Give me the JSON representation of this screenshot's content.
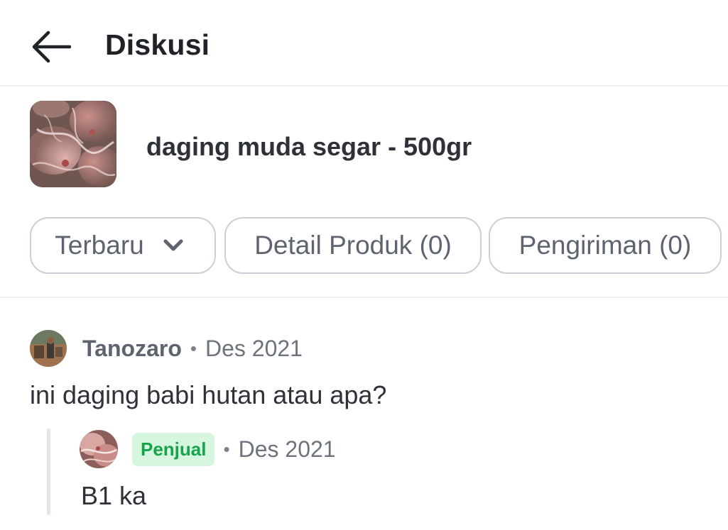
{
  "header": {
    "title": "Diskusi",
    "back_icon": "arrow-left-icon"
  },
  "product": {
    "name": "daging muda segar - 500gr"
  },
  "filters": {
    "sort_label": "Terbaru",
    "sort_icon": "chevron-down-icon",
    "tabs": [
      {
        "label": "Detail Produk (0)"
      },
      {
        "label": "Pengiriman (0)"
      }
    ]
  },
  "question": {
    "user": "Tanozaro",
    "separator": "•",
    "date": "Des 2021",
    "text": "ini daging babi hutan atau apa?"
  },
  "reply": {
    "badge": "Penjual",
    "separator": "•",
    "date": "Des 2021",
    "text": "B1 ka"
  },
  "colors": {
    "seller_badge_bg": "#d6f6e0",
    "seller_badge_text": "#17a34a",
    "chip_border": "#c9cfd7"
  }
}
